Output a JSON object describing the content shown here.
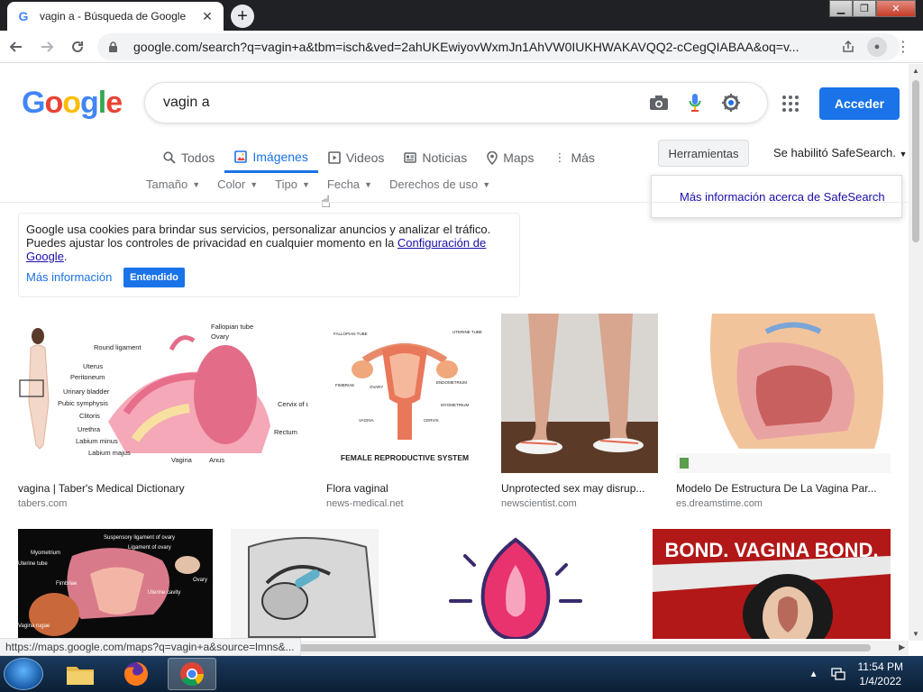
{
  "browser": {
    "tab_title": "vagin a - Búsqueda de Google",
    "new_tab_label": "+",
    "url": "google.com/search?q=vagin+a&tbm=isch&ved=2ahUKEwiyovWxmJn1AhVW0IUKHWAKAVQQ2-cCegQIABAA&oq=v...",
    "status_url": "https://maps.google.com/maps?q=vagin+a&source=lmns&..."
  },
  "google": {
    "logo_letters": [
      "G",
      "o",
      "o",
      "g",
      "l",
      "e"
    ],
    "query": "vagin a",
    "signin_label": "Acceder",
    "tabs": [
      {
        "label": "Todos",
        "icon": "search-icon"
      },
      {
        "label": "Imágenes",
        "icon": "image-icon",
        "active": true
      },
      {
        "label": "Videos",
        "icon": "video-icon"
      },
      {
        "label": "Noticias",
        "icon": "news-icon"
      },
      {
        "label": "Maps",
        "icon": "map-pin-icon"
      },
      {
        "label": "Más",
        "icon": "more-vert-icon"
      }
    ],
    "tools_label": "Herramientas",
    "safesearch_label": "Se habilitó SafeSearch.",
    "safesearch_more": "Más información acerca de SafeSearch",
    "filters": [
      "Tamaño",
      "Color",
      "Tipo",
      "Fecha",
      "Derechos de uso"
    ]
  },
  "cookie": {
    "text_line1": "Google usa cookies para brindar sus servicios, personalizar anuncios y analizar el tráfico.",
    "text_line2": "Puedes ajustar los controles de privacidad en cualquier momento en la",
    "link": "Configuración de Google",
    "more": "Más información",
    "ok": "Entendido"
  },
  "results": [
    {
      "caption": "vagina | Taber's Medical Dictionary",
      "source": "tabers.com"
    },
    {
      "caption": "Flora vaginal",
      "source": "news-medical.net"
    },
    {
      "caption": "Unprotected sex may disrup...",
      "source": "newscientist.com"
    },
    {
      "caption": "Modelo De Estructura De La Vagina Par...",
      "source": "es.dreamstime.com"
    }
  ],
  "thumb_text": {
    "tabers_labels": [
      "Fallopian tube",
      "Ovary",
      "Round ligament",
      "Uterus",
      "Peritoneum",
      "Urinary bladder",
      "Pubic symphysis",
      "Clitoris",
      "Urethra",
      "Labium minus",
      "Labium majus",
      "Vagina",
      "Anus",
      "Rectum",
      "Cervix of uterus"
    ],
    "repro_title": "FEMALE REPRODUCTIVE SYSTEM",
    "repro_labels": [
      "FALLOPIAN TUBE",
      "UTERINE TUBE",
      "FIMBRIAE",
      "OVARY",
      "ENDOMETRIUM",
      "MYOMETRIUM",
      "CERVIX",
      "VAGINA"
    ],
    "ovary_labels": [
      "Suspensory ligament of ovary",
      "Ligament of ovary",
      "Myometrium",
      "Uterine tube",
      "Ovary",
      "Fimbriae",
      "Uterine cavity",
      "Vagina rugae"
    ],
    "bond_text": "BOND. VAGINA BOND."
  },
  "taskbar": {
    "time": "11:54 PM",
    "date": "1/4/2022"
  }
}
